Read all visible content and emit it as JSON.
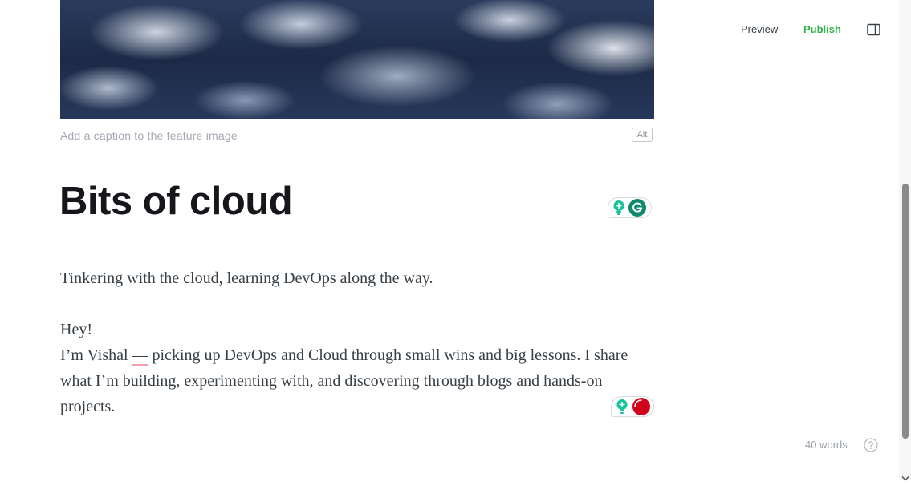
{
  "editor": {
    "feature_image": {
      "caption_placeholder": "Add a caption to the feature image",
      "alt_label": "Alt"
    },
    "title": "Bits of cloud",
    "excerpt": "Tinkering with the cloud, learning DevOps along the way.",
    "body": {
      "greeting": "Hey!",
      "intro_before_dash": "I’m Vishal ",
      "dash": "—",
      "intro_after_dash": " picking up DevOps and Cloud through small wins and big lessons. I share what I’m building, experimenting with, and discovering through blogs and hands-on projects."
    },
    "word_count": "40 words"
  },
  "topbar": {
    "preview_label": "Preview",
    "publish_label": "Publish"
  },
  "colors": {
    "publish": "#2fb344",
    "grammarly": "#15c39a",
    "grammarly_alert": "#d0021b",
    "text": "#15171a"
  },
  "icons": [
    "lightbulb-icon",
    "grammarly-icon",
    "grammarly-alert-icon",
    "sidebar-toggle-icon",
    "help-icon"
  ]
}
